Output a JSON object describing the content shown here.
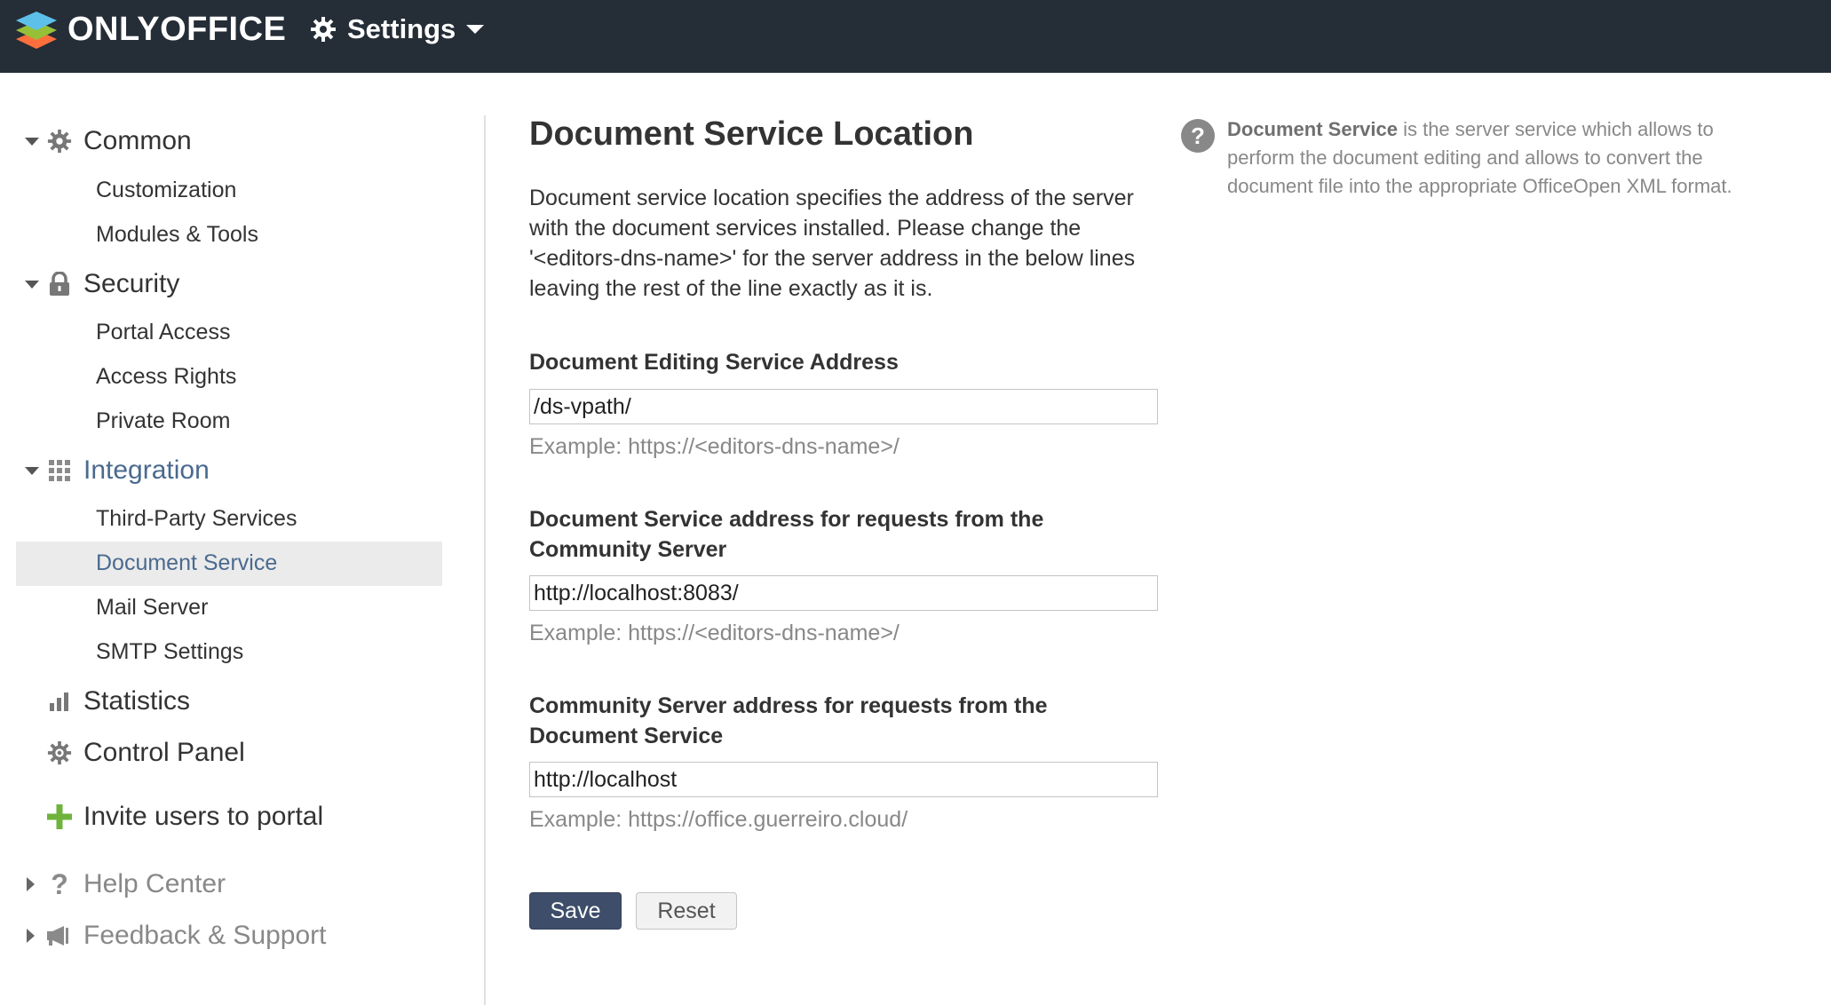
{
  "header": {
    "logo_text": "ONLYOFFICE",
    "settings_label": "Settings"
  },
  "sidebar": {
    "common": {
      "label": "Common",
      "items": [
        "Customization",
        "Modules & Tools"
      ]
    },
    "security": {
      "label": "Security",
      "items": [
        "Portal Access",
        "Access Rights",
        "Private Room"
      ]
    },
    "integration": {
      "label": "Integration",
      "items": [
        "Third-Party Services",
        "Document Service",
        "Mail Server",
        "SMTP Settings"
      ]
    },
    "statistics": "Statistics",
    "control_panel": "Control Panel",
    "invite": "Invite users to portal",
    "help_center": "Help Center",
    "feedback": "Feedback & Support",
    "active_item": "Document Service"
  },
  "main": {
    "title": "Document Service Location",
    "description": "Document service location specifies the address of the server with the document services installed. Please change the '<editors-dns-name>' for the server address in the below lines leaving the rest of the line exactly as it is.",
    "fields": [
      {
        "label": "Document Editing Service Address",
        "value": "/ds-vpath/",
        "example": "Example: https://<editors-dns-name>/"
      },
      {
        "label": "Document Service address for requests from the Community Server",
        "value": "http://localhost:8083/",
        "example": "Example: https://<editors-dns-name>/"
      },
      {
        "label": "Community Server address for requests from the Document Service",
        "value": "http://localhost",
        "example": "Example: https://office.guerreiro.cloud/"
      }
    ],
    "save_label": "Save",
    "reset_label": "Reset"
  },
  "help": {
    "icon_char": "?",
    "bold": "Document Service",
    "text": " is the server service which allows to perform the document editing and allows to convert the document file into the appropriate OfficeOpen XML format."
  },
  "colors": {
    "topbar": "#252d37",
    "accent": "#4a6a8f",
    "save_button": "#3e4e6a",
    "invite_plus": "#6fb33c"
  }
}
